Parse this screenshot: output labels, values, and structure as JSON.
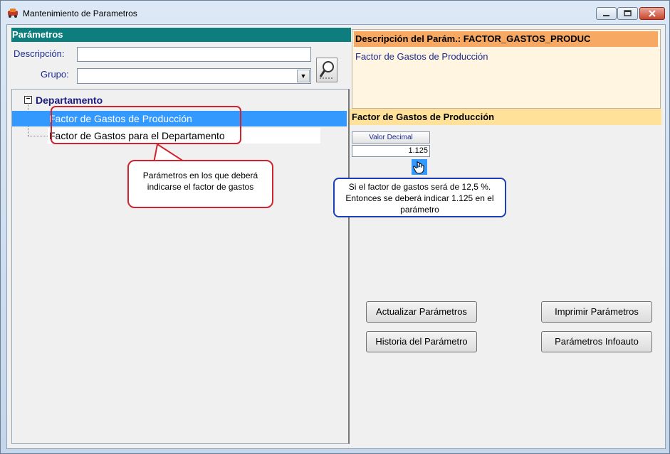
{
  "window": {
    "title": "Mantenimiento de Parametros"
  },
  "left": {
    "section_title": "Parámetros",
    "descripcion_label": "Descripción:",
    "descripcion_value": "",
    "grupo_label": "Grupo:",
    "grupo_value": "",
    "tree": {
      "root": "Departamento",
      "items": [
        {
          "label": "Factor de Gastos de Producción",
          "selected": true
        },
        {
          "label": "Factor de Gastos para el Departamento",
          "selected": false
        }
      ]
    },
    "callout": "Parámetros en los que deberá indicarse el factor de gastos"
  },
  "right": {
    "desc_header": "Descripción del Parám.: FACTOR_GASTOS_PRODUC",
    "desc_text": "Factor de Gastos de Producción",
    "param_header": "Factor de Gastos de Producción",
    "value_header": "Valor Decimal",
    "value": "1.125",
    "callout": "Si el factor de gastos será de 12,5 %. Entonces se deberá indicar 1.125 en el parámetro",
    "buttons": {
      "actualizar": "Actualizar Parámetros",
      "imprimir": "Imprimir Parámetros",
      "historia": "Historia del Parámetro",
      "infoauto": "Parámetros Infoauto"
    }
  },
  "colors": {
    "left_header": "#0d7d7d",
    "desc_header": "#f7a964",
    "param_header": "#ffe19a",
    "selection": "#3399ff",
    "red_callout": "#d0232e",
    "blue_callout": "#1c3fb5"
  }
}
